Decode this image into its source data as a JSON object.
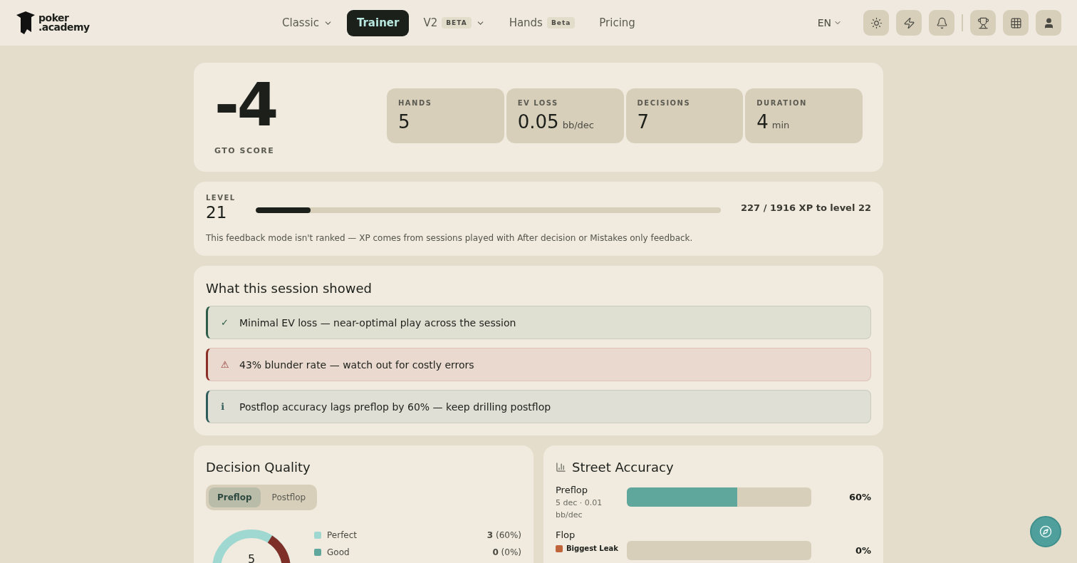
{
  "nav": {
    "logo": [
      "poker",
      ".academy"
    ],
    "links": [
      {
        "label": "Classic",
        "selected": false,
        "caret": true
      },
      {
        "label": "Trainer",
        "selected": true,
        "caret": false
      },
      {
        "label": "V2",
        "badge": "BETA",
        "selected": false,
        "caret": true
      },
      {
        "label": "Hands",
        "badge": "Beta",
        "selected": false,
        "caret": false
      },
      {
        "label": "Pricing",
        "selected": false,
        "caret": false
      }
    ],
    "language": "EN"
  },
  "score": {
    "value": "-4",
    "label": "GTO SCORE",
    "stats": [
      {
        "label": "HANDS",
        "value": "5"
      },
      {
        "label": "EV LOSS",
        "value": "0.05",
        "unit": "bb/dec"
      },
      {
        "label": "DECISIONS",
        "value": "7"
      },
      {
        "label": "DURATION",
        "value": "4",
        "unit": "min"
      }
    ]
  },
  "level": {
    "label": "LEVEL",
    "value": "21",
    "level": 0.118,
    "xp": "227 / 1916 XP to level 22",
    "note": "This feedback mode isn't ranked — XP comes from sessions played with After decision or Mistakes only feedback."
  },
  "insights": {
    "title": "What this session showed",
    "items": [
      {
        "kind": "success",
        "icon": "✓",
        "text": "Minimal EV loss — near-optimal play across the session"
      },
      {
        "kind": "danger",
        "icon": "⚠",
        "text": "43% blunder rate — watch out for costly errors"
      },
      {
        "kind": "info",
        "icon": "ℹ",
        "text": "Postflop accuracy lags preflop by 60% — keep drilling postflop"
      }
    ]
  },
  "decision_quality": {
    "title": "Decision Quality",
    "tabs": [
      {
        "label": "Preflop",
        "selected": true
      },
      {
        "label": "Postflop",
        "selected": false
      }
    ],
    "total": "5",
    "legend": [
      {
        "label": "Perfect",
        "color": "#9fd8d0",
        "count": "3",
        "share": "(60%)"
      },
      {
        "label": "Good",
        "color": "#5fa79c",
        "count": "0",
        "share": "(0%)"
      }
    ]
  },
  "street_accuracy": {
    "title": "Street Accuracy",
    "rows": [
      {
        "street": "Preflop",
        "detail": "5 dec · 0.01 bb/dec",
        "level": 0.6,
        "reading": "60%"
      },
      {
        "street": "Flop",
        "leak": {
          "label": "Biggest Leak",
          "color": "#c0643c"
        },
        "level": 0,
        "reading": "0%"
      }
    ]
  }
}
